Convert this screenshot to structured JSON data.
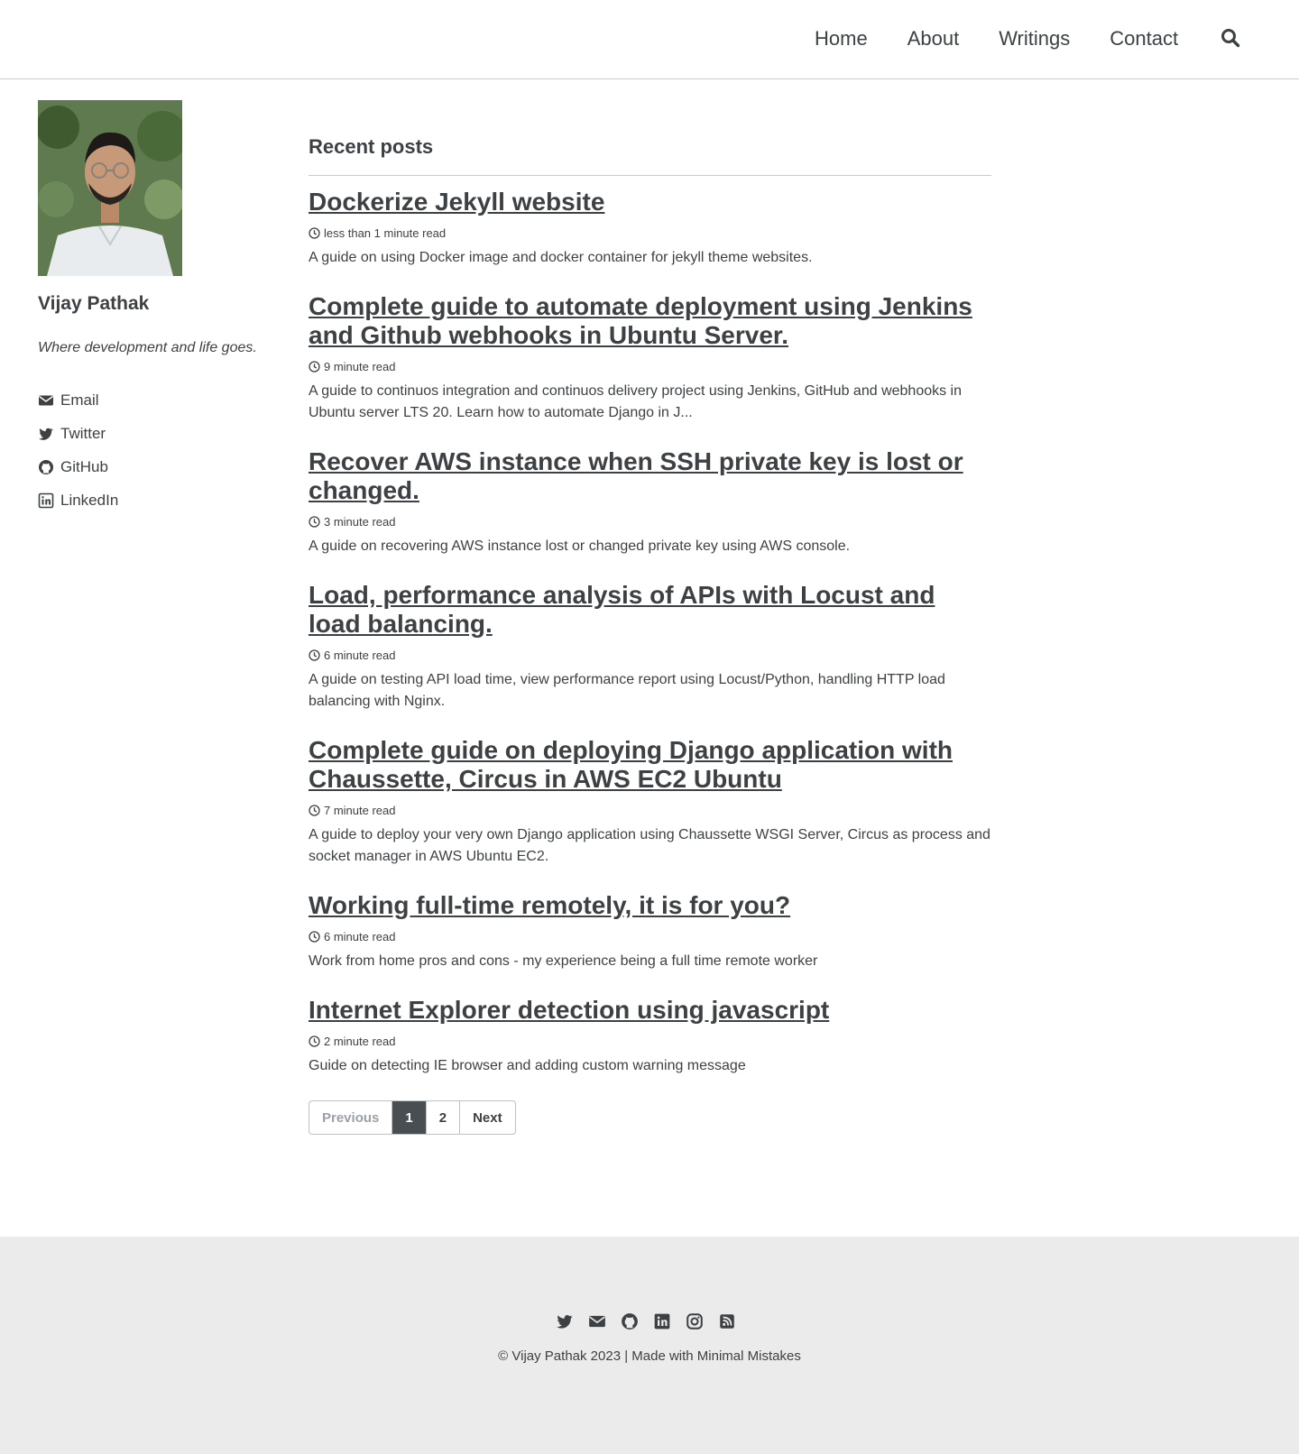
{
  "nav": {
    "items": [
      "Home",
      "About",
      "Writings",
      "Contact"
    ],
    "search_icon": "search-icon"
  },
  "sidebar": {
    "name": "Vijay Pathak",
    "bio": "Where development and life goes.",
    "links": [
      {
        "label": "Email",
        "icon": "envelope-icon"
      },
      {
        "label": "Twitter",
        "icon": "twitter-icon"
      },
      {
        "label": "GitHub",
        "icon": "github-icon"
      },
      {
        "label": "LinkedIn",
        "icon": "linkedin-icon"
      }
    ]
  },
  "main": {
    "section_title": "Recent posts",
    "posts": [
      {
        "title": "Dockerize Jekyll website",
        "read_time": "less than 1 minute read",
        "excerpt": "A guide on using Docker image and docker container for jekyll theme websites."
      },
      {
        "title": "Complete guide to automate deployment using Jenkins and Github webhooks in Ubuntu Server.",
        "read_time": "9 minute read",
        "excerpt": "A guide to continuos integration and continuos delivery project using Jenkins, GitHub and webhooks in Ubuntu server LTS 20. Learn how to automate Django in J..."
      },
      {
        "title": "Recover AWS instance when SSH private key is lost or changed.",
        "read_time": "3 minute read",
        "excerpt": "A guide on recovering AWS instance lost or changed private key using AWS console."
      },
      {
        "title": "Load, performance analysis of APIs with Locust and load balancing.",
        "read_time": "6 minute read",
        "excerpt": "A guide on testing API load time, view performance report using Locust/Python, handling HTTP load balancing with Nginx."
      },
      {
        "title": "Complete guide on deploying Django application with Chaussette, Circus in AWS EC2 Ubuntu",
        "read_time": "7 minute read",
        "excerpt": "A guide to deploy your very own Django application using Chaussette WSGI Server, Circus as process and socket manager in AWS Ubuntu EC2."
      },
      {
        "title": "Working full-time remotely, it is for you?",
        "read_time": "6 minute read",
        "excerpt": "Work from home pros and cons - my experience being a full time remote worker"
      },
      {
        "title": "Internet Explorer detection using javascript",
        "read_time": "2 minute read",
        "excerpt": "Guide on detecting IE browser and adding custom warning message"
      }
    ]
  },
  "pagination": {
    "previous": "Previous",
    "pages": [
      "1",
      "2"
    ],
    "current": "1",
    "next": "Next"
  },
  "footer": {
    "icons": [
      "twitter-icon",
      "envelope-icon",
      "github-icon",
      "linkedin-icon",
      "instagram-icon",
      "rss-icon"
    ],
    "copyright": "© Vijay Pathak 2023 | Made with Minimal Mistakes"
  },
  "colors": {
    "text": "#3d4144",
    "border": "#c9cbcc",
    "footer_bg": "#ebebeb",
    "pagination_active": "#494e52"
  }
}
